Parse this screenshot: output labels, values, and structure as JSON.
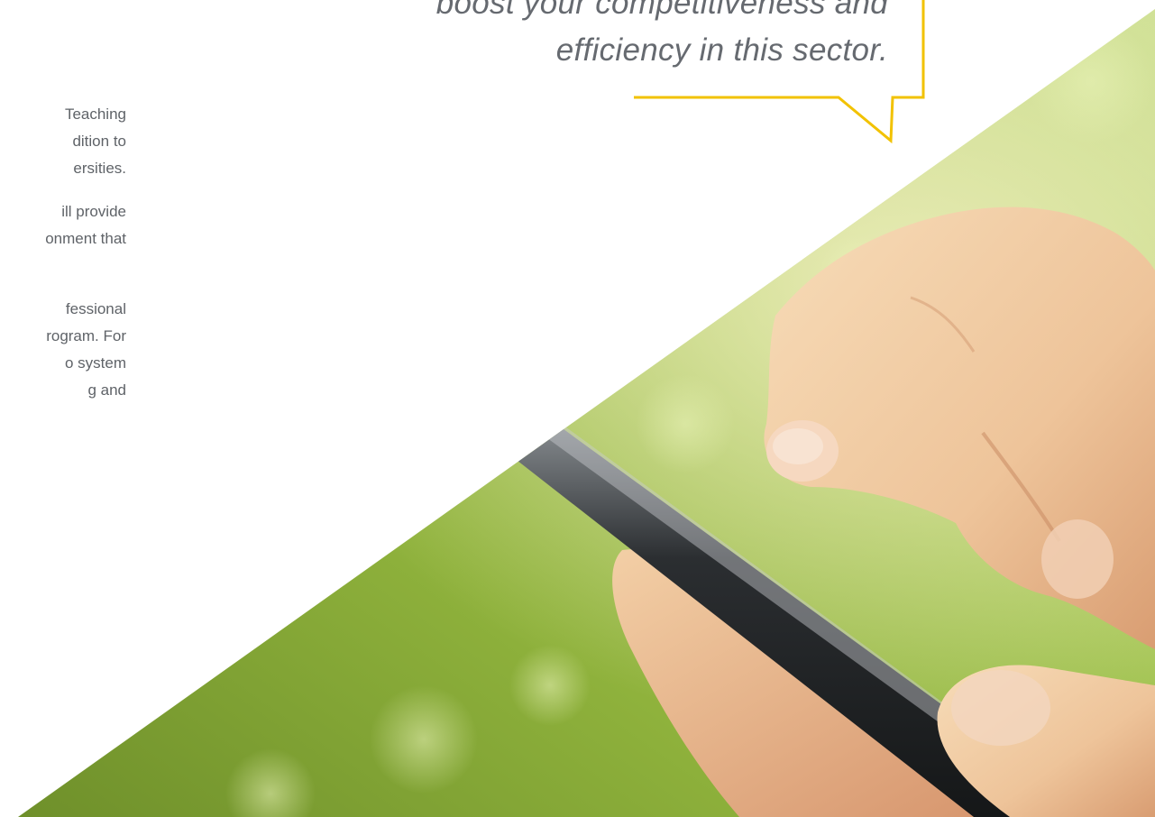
{
  "quote": {
    "lines": [
      "boost your competitiveness and",
      "efficiency in this sector."
    ]
  },
  "body_text": {
    "paragraphs": [
      [
        "Teaching",
        "dition to",
        "ersities."
      ],
      [
        "ill provide",
        "onment that"
      ],
      [
        "fessional",
        "rogram. For",
        "o system",
        "g and"
      ]
    ]
  },
  "colors": {
    "accent": "#f2c200",
    "text": "#5f6368",
    "quote_text": "#666a70"
  },
  "image": {
    "subject": "hand-using-smartphone-photo"
  }
}
